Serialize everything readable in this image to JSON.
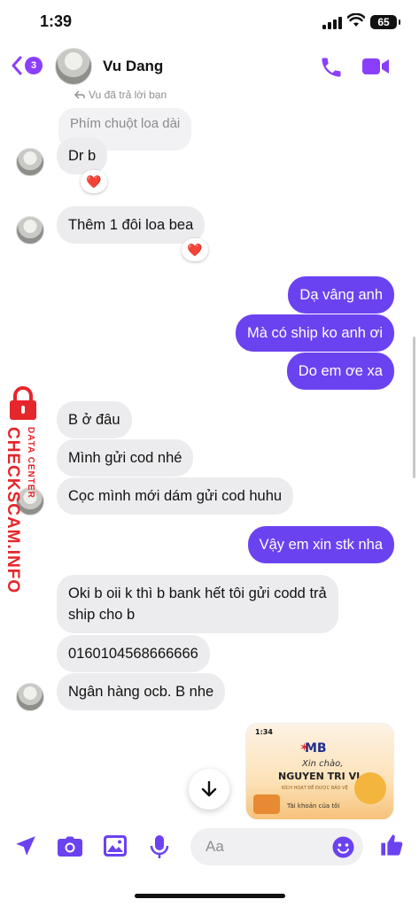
{
  "status_bar": {
    "time": "1:39",
    "battery": "65"
  },
  "header": {
    "back_badge": "3",
    "contact_name": "Vu Dang"
  },
  "reply_note": "Vu đã trả lời bạn",
  "quoted_message": "Phím chuột loa dài",
  "messages": [
    {
      "side": "in",
      "text": "Dr b",
      "reaction": "❤️"
    },
    {
      "side": "in",
      "text": "Thêm 1 đôi loa bea",
      "reaction": "❤️"
    },
    {
      "side": "out",
      "text": "Dạ vâng anh"
    },
    {
      "side": "out",
      "text": "Mà có ship ko anh ơi"
    },
    {
      "side": "out",
      "text": "Do em ơe xa"
    },
    {
      "side": "in",
      "text": "B ở đâu"
    },
    {
      "side": "in",
      "text": "Mình gửi cod nhé"
    },
    {
      "side": "in",
      "text": "Cọc mình mới dám gửi cod huhu"
    },
    {
      "side": "out",
      "text": "Vậy em xin stk nha"
    },
    {
      "side": "in",
      "text": "Oki b oii k thì b bank hết tôi gửi codd trả ship cho b"
    },
    {
      "side": "in",
      "text": "0160104568666666"
    },
    {
      "side": "in",
      "text": "Ngân hàng ocb. B nhe"
    }
  ],
  "screenshot_attachment": {
    "time": "1:34",
    "bank": "MB",
    "greeting": "Xin chào,",
    "account_name": "NGUYEN TRI VI",
    "small_text": "KÍCH HOẠT ĐỂ ĐƯỢC BẢO VỆ",
    "account_label": "Tài khoản của tôi"
  },
  "composer": {
    "placeholder": "Aa"
  },
  "watermark": {
    "brand": "CHECKSCAM.INFO",
    "sub": "DATA CENTER"
  },
  "colors": {
    "accent": "#6b42f0",
    "header_icons": "#8a3ffc",
    "incoming": "#ececee",
    "watermark": "#e5262b"
  },
  "icons": [
    "back-chevron-icon",
    "phone-icon",
    "video-icon",
    "send-location-icon",
    "camera-icon",
    "gallery-icon",
    "mic-icon",
    "emoji-icon",
    "like-icon",
    "arrow-down-icon"
  ]
}
